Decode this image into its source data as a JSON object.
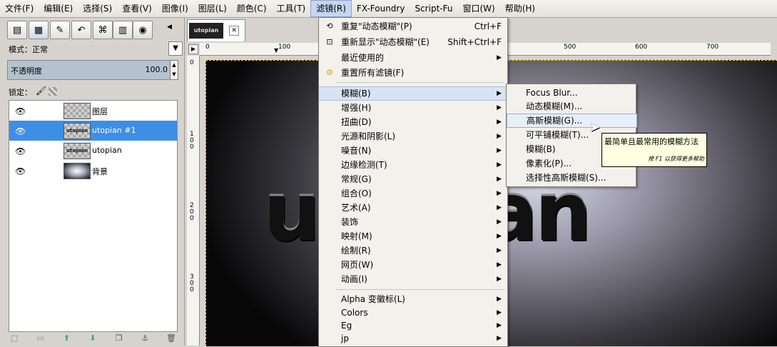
{
  "menubar": {
    "items": [
      {
        "label": "文件(F)"
      },
      {
        "label": "编辑(E)"
      },
      {
        "label": "选择(S)"
      },
      {
        "label": "查看(V)"
      },
      {
        "label": "图像(I)"
      },
      {
        "label": "图层(L)"
      },
      {
        "label": "颜色(C)"
      },
      {
        "label": "工具(T)"
      },
      {
        "label": "滤镜(R)"
      },
      {
        "label": "FX-Foundry"
      },
      {
        "label": "Script-Fu"
      },
      {
        "label": "窗口(W)"
      },
      {
        "label": "帮助(H)"
      }
    ]
  },
  "layers_panel": {
    "mode_label": "模式：正常",
    "opacity_label": "不透明度",
    "opacity_value": "100.0",
    "lock_label": "锁定：",
    "layers": [
      {
        "name": "图层",
        "thumb": ""
      },
      {
        "name": "utopian #1",
        "thumb": "utopian"
      },
      {
        "name": "utopian",
        "thumb": "utopian"
      },
      {
        "name": "背景",
        "thumb": ""
      }
    ]
  },
  "canvas": {
    "tab_thumb_text": "utopian",
    "image_text": "utopian",
    "ruler_h_ticks": [
      "0",
      "100",
      "500",
      "600",
      "700"
    ],
    "ruler_v_ticks": [
      "0",
      "1\n0\n0",
      "2\n0\n0",
      "3\n0\n0"
    ]
  },
  "filters_menu": {
    "repeat": {
      "label": "重复\"动态模糊\"(P)",
      "accel": "Ctrl+F"
    },
    "reshow": {
      "label": "重新显示\"动态模糊\"(E)",
      "accel": "Shift+Ctrl+F"
    },
    "recent": {
      "label": "最近使用的"
    },
    "reset": {
      "label": "重置所有滤镜(F)"
    },
    "groups": [
      {
        "label": "模糊(B)"
      },
      {
        "label": "增强(H)"
      },
      {
        "label": "扭曲(D)"
      },
      {
        "label": "光源和阴影(L)"
      },
      {
        "label": "噪音(N)"
      },
      {
        "label": "边缘检测(T)"
      },
      {
        "label": "常规(G)"
      },
      {
        "label": "组合(O)"
      },
      {
        "label": "艺术(A)"
      },
      {
        "label": "装饰"
      },
      {
        "label": "映射(M)"
      },
      {
        "label": "绘制(R)"
      },
      {
        "label": "网页(W)"
      },
      {
        "label": "动画(I)"
      }
    ],
    "extras": [
      {
        "label": "Alpha 变徽标(L)"
      },
      {
        "label": "Colors"
      },
      {
        "label": "Eg"
      },
      {
        "label": "jp"
      }
    ]
  },
  "blur_menu": {
    "items": [
      {
        "label": "Focus Blur..."
      },
      {
        "label": "动态模糊(M)..."
      },
      {
        "label": "高斯模糊(G)..."
      },
      {
        "label": "可平铺模糊(T)..."
      },
      {
        "label": "模糊(B)"
      },
      {
        "label": "像素化(P)..."
      },
      {
        "label": "选择性高斯模糊(S)..."
      }
    ]
  },
  "tooltip": {
    "main": "最简单且最常用的模糊方法",
    "sub": "按 F1 以获得更多帮助"
  },
  "colors": {
    "selected_layer": "#3d8ee6",
    "menu_highlight": "#d8e3f3",
    "tooltip_bg": "#ffffe1"
  }
}
